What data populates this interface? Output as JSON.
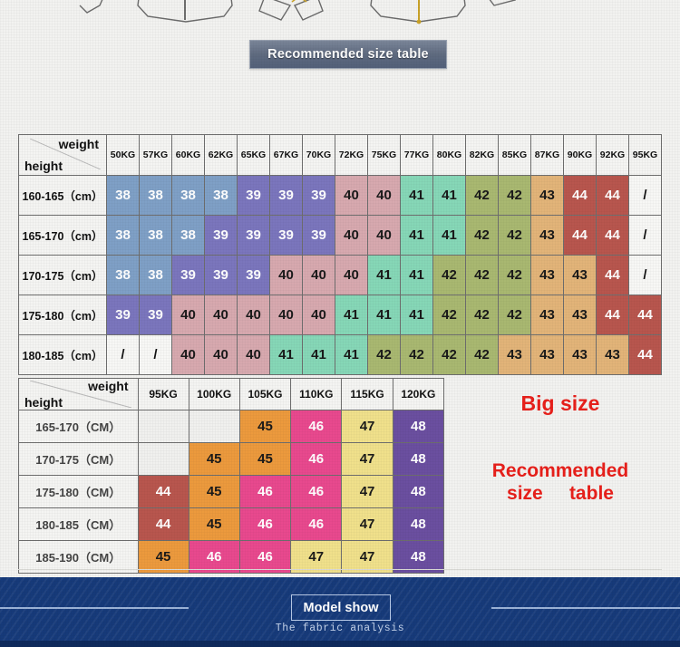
{
  "banner": {
    "title": "Recommended size table"
  },
  "headers": {
    "weight_label": "weight",
    "height_label": "height"
  },
  "callout": {
    "big_size": "Big size",
    "rec_line1": "Recommended",
    "rec_line2": "size",
    "rec_line3": "table"
  },
  "footer": {
    "title": "Model show",
    "subtitle": "The fabric analysis"
  },
  "chart_data": {
    "type": "table",
    "title": "Recommended size table",
    "tables": [
      {
        "name": "standard-size-table",
        "corner_weight": "weight",
        "corner_height": "height",
        "columns": [
          "50KG",
          "57KG",
          "60KG",
          "62KG",
          "65KG",
          "67KG",
          "70KG",
          "72KG",
          "75KG",
          "77KG",
          "80KG",
          "82KG",
          "85KG",
          "87KG",
          "90KG",
          "92KG",
          "95KG"
        ],
        "rows": [
          {
            "height": "160-165（cm）",
            "values": [
              "38",
              "38",
              "38",
              "38",
              "39",
              "39",
              "39",
              "40",
              "40",
              "41",
              "41",
              "42",
              "42",
              "43",
              "44",
              "44",
              "/"
            ]
          },
          {
            "height": "165-170（cm）",
            "values": [
              "38",
              "38",
              "38",
              "39",
              "39",
              "39",
              "39",
              "40",
              "40",
              "41",
              "41",
              "42",
              "42",
              "43",
              "44",
              "44",
              "/"
            ]
          },
          {
            "height": "170-175（cm）",
            "values": [
              "38",
              "38",
              "39",
              "39",
              "39",
              "40",
              "40",
              "40",
              "41",
              "41",
              "42",
              "42",
              "42",
              "43",
              "43",
              "44",
              "/"
            ]
          },
          {
            "height": "175-180（cm）",
            "values": [
              "39",
              "39",
              "40",
              "40",
              "40",
              "40",
              "40",
              "41",
              "41",
              "41",
              "42",
              "42",
              "42",
              "43",
              "43",
              "44",
              "44"
            ]
          },
          {
            "height": "180-185（cm）",
            "values": [
              "/",
              "/",
              "40",
              "40",
              "40",
              "41",
              "41",
              "41",
              "42",
              "42",
              "42",
              "42",
              "43",
              "43",
              "43",
              "43",
              "44"
            ]
          }
        ]
      },
      {
        "name": "big-size-table",
        "corner_weight": "weight",
        "corner_height": "height",
        "columns": [
          "95KG",
          "100KG",
          "105KG",
          "110KG",
          "115KG",
          "120KG"
        ],
        "rows": [
          {
            "height": "165-170（CM）",
            "values": [
              "",
              "",
              "45",
              "46",
              "47",
              "48"
            ]
          },
          {
            "height": "170-175（CM）",
            "values": [
              "",
              "45",
              "45",
              "46",
              "47",
              "48"
            ]
          },
          {
            "height": "175-180（CM）",
            "values": [
              "44",
              "45",
              "46",
              "46",
              "47",
              "48"
            ]
          },
          {
            "height": "180-185（CM）",
            "values": [
              "44",
              "45",
              "46",
              "46",
              "47",
              "48"
            ]
          },
          {
            "height": "185-190（CM）",
            "values": [
              "45",
              "46",
              "46",
              "47",
              "47",
              "48"
            ]
          }
        ]
      }
    ]
  },
  "colors": {
    "size_38": "#7fa0c6",
    "size_39": "#7b76bd",
    "size_40": "#d7a9af",
    "size_41": "#86d7b7",
    "size_42": "#a9b871",
    "size_43": "#e2b479",
    "size_44": "#b8564e",
    "size_45": "#ec9a3d",
    "size_46": "#e8498e",
    "size_47": "#f0e08b",
    "size_48": "#6b4fa0",
    "banner_bg": "#5f6b80",
    "callout_red": "#e8201b",
    "footer_blue": "#163a7a"
  }
}
